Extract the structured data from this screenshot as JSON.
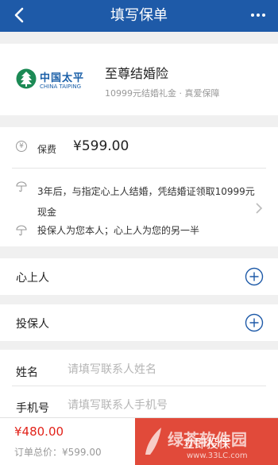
{
  "nav": {
    "title": "填写保单"
  },
  "product": {
    "logo_cn": "中国太平",
    "logo_en": "CHINA TAIPING",
    "name": "至尊结婚险",
    "subtitle": "10999元结婚礼金 · 真爱保障"
  },
  "fee": {
    "icon_text": "¥",
    "label": "保费",
    "value": "¥599.00"
  },
  "notes": {
    "line1": "3年后，与指定心上人结婚，凭结婚证领取10999元现金",
    "line2": "投保人为您本人；心上人为您的另一半"
  },
  "sections": {
    "sweetheart": "心上人",
    "policyholder": "投保人"
  },
  "form": {
    "name_label": "姓名",
    "name_placeholder": "请填写联系人姓名",
    "phone_label": "手机号",
    "phone_placeholder": "请填写联系人手机号"
  },
  "footer": {
    "price": "¥480.00",
    "original": "订单总价：¥599.00",
    "buy_label": "立即投保",
    "buy_color": "#e14a3a",
    "watermark_text": "绿茶软件园",
    "watermark_url": "www.33LC.com"
  },
  "colors": {
    "nav": "#1e5aa8",
    "price": "#e2231a",
    "brand": "#1a5fa8"
  }
}
